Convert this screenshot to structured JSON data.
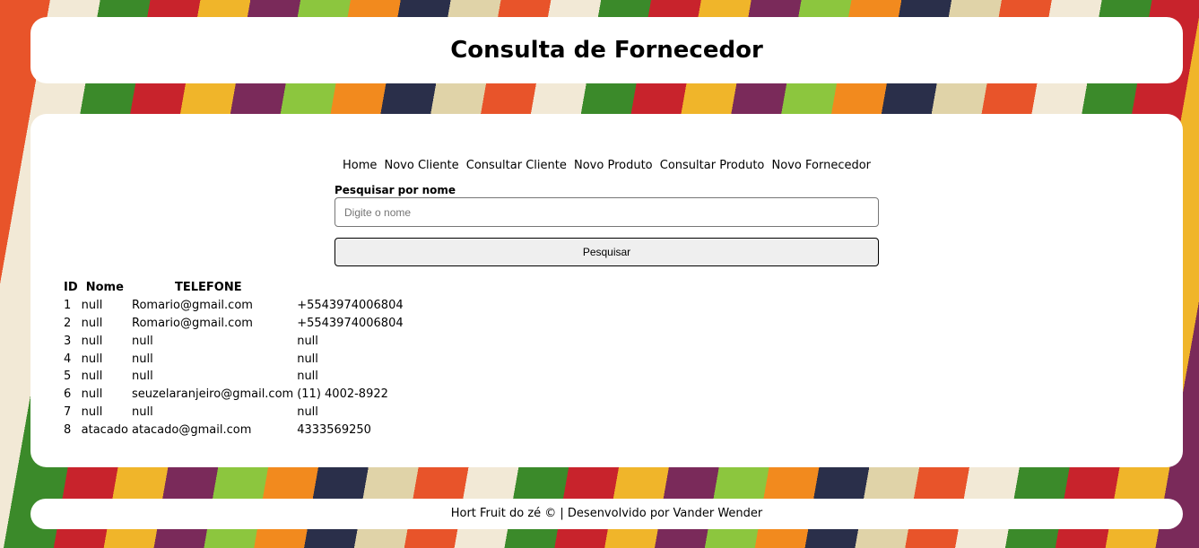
{
  "header": {
    "title": "Consulta de Fornecedor"
  },
  "nav": {
    "items": [
      "Home",
      "Novo",
      "Cliente",
      "Consultar",
      "Cliente",
      "Novo",
      "Produto",
      "Consultar",
      "Produto",
      "Novo",
      "Fornecedor"
    ]
  },
  "search": {
    "label": "Pesquisar por nome",
    "placeholder": "Digite o nome",
    "button_label": "Pesquisar"
  },
  "table": {
    "headers": [
      "ID",
      "Nome",
      "TELEFONE"
    ],
    "rows": [
      [
        "1",
        "null",
        "Romario@gmail.com",
        "+5543974006804"
      ],
      [
        "2",
        "null",
        "Romario@gmail.com",
        "+5543974006804"
      ],
      [
        "3",
        "null",
        "null",
        "null"
      ],
      [
        "4",
        "null",
        "null",
        "null"
      ],
      [
        "5",
        "null",
        "null",
        "null"
      ],
      [
        "6",
        "null",
        "seuzelaranjeiro@gmail.com",
        "(11) 4002-8922"
      ],
      [
        "7",
        "null",
        "null",
        "null"
      ],
      [
        "8",
        "atacado",
        "atacado@gmail.com",
        "4333569250"
      ]
    ]
  },
  "footer": {
    "text": "Hort Fruit do zé © | Desenvolvido por Vander Wender"
  }
}
